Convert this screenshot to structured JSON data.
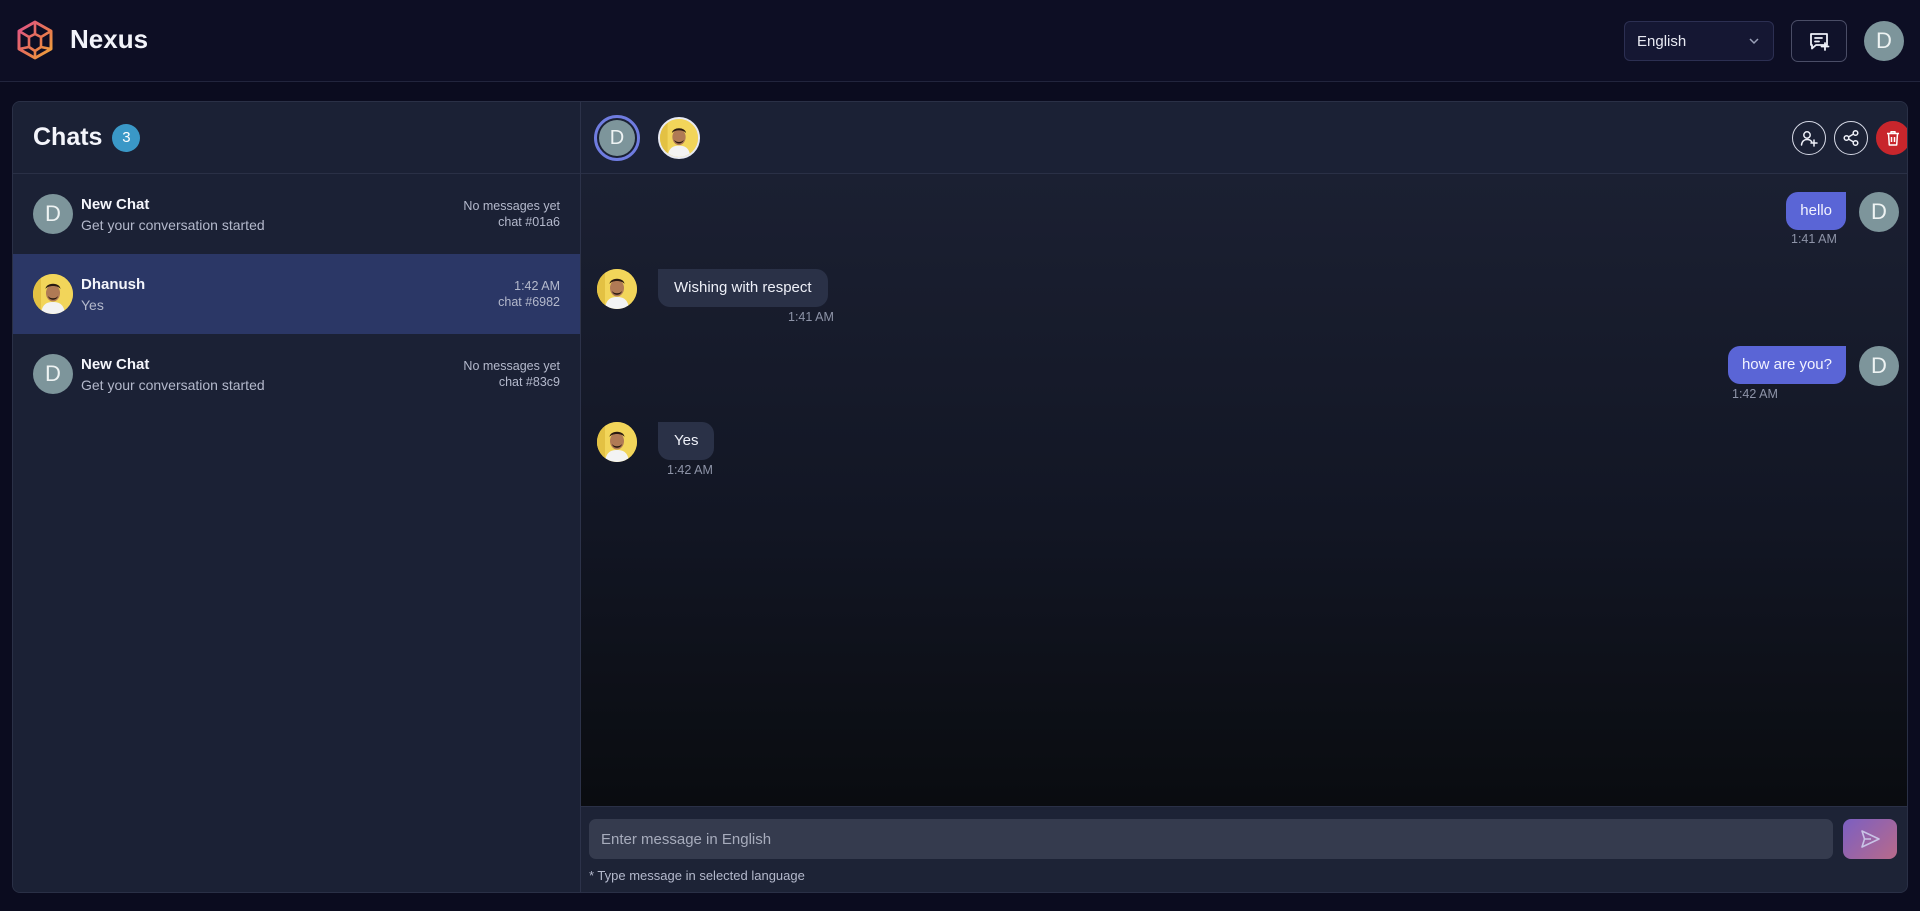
{
  "app": {
    "name": "Nexus"
  },
  "header": {
    "language": "English",
    "user_initial": "D"
  },
  "sidebar": {
    "title": "Chats",
    "count": "3",
    "chats": [
      {
        "name": "New Chat",
        "preview": "Get your conversation started",
        "meta_top": "No messages yet",
        "meta_id": "chat #01a6",
        "avatar": "D"
      },
      {
        "name": "Dhanush",
        "preview": "Yes",
        "meta_top": "1:42 AM",
        "meta_id": "chat #6982",
        "avatar": "photo"
      },
      {
        "name": "New Chat",
        "preview": "Get your conversation started",
        "meta_top": "No messages yet",
        "meta_id": "chat #83c9",
        "avatar": "D"
      }
    ]
  },
  "conversation": {
    "self_initial": "D",
    "messages": [
      {
        "direction": "out",
        "text": "hello",
        "time": "1:41 AM"
      },
      {
        "direction": "in",
        "text": "Wishing with respect",
        "time": "1:41 AM"
      },
      {
        "direction": "out",
        "text": "how are you?",
        "time": "1:42 AM"
      },
      {
        "direction": "in",
        "text": "Yes",
        "time": "1:42 AM"
      }
    ]
  },
  "composer": {
    "placeholder": "Enter message in English",
    "hint": "* Type message in selected language"
  },
  "colors": {
    "accent": "#5a65d6",
    "badge": "#3a98c7",
    "danger": "#c8262c",
    "active_row": "#2b3766"
  }
}
